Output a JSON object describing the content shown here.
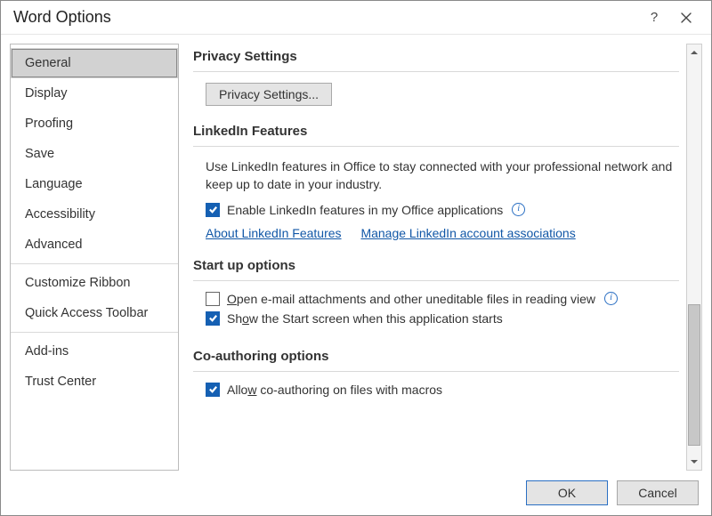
{
  "title": "Word Options",
  "sidebar": {
    "items": [
      {
        "label": "General",
        "selected": true
      },
      {
        "label": "Display"
      },
      {
        "label": "Proofing"
      },
      {
        "label": "Save"
      },
      {
        "label": "Language"
      },
      {
        "label": "Accessibility"
      },
      {
        "label": "Advanced"
      },
      {
        "separator": true
      },
      {
        "label": "Customize Ribbon"
      },
      {
        "label": "Quick Access Toolbar"
      },
      {
        "separator": true
      },
      {
        "label": "Add-ins"
      },
      {
        "label": "Trust Center"
      }
    ]
  },
  "sections": {
    "privacy": {
      "title": "Privacy Settings",
      "button": "Privacy Settings..."
    },
    "linkedin": {
      "title": "LinkedIn Features",
      "desc": "Use LinkedIn features in Office to stay connected with your professional network and keep up to date in your industry.",
      "checkbox": {
        "checked": true,
        "label": "Enable LinkedIn features in my Office applications"
      },
      "link1": "About LinkedIn Features",
      "link2": "Manage LinkedIn account associations"
    },
    "startup": {
      "title": "Start up options",
      "cb1": {
        "checked": false,
        "pre": "O",
        "post": "pen e-mail attachments and other uneditable files in reading view"
      },
      "cb2": {
        "checked": true,
        "pre": "Sh",
        "mid": "o",
        "post": "w the Start screen when this application starts"
      }
    },
    "coauth": {
      "title": "Co-authoring options",
      "cb": {
        "checked": true,
        "pre": "Allo",
        "mid": "w",
        "post": " co-authoring on files with macros"
      }
    }
  },
  "footer": {
    "ok": "OK",
    "cancel": "Cancel"
  }
}
